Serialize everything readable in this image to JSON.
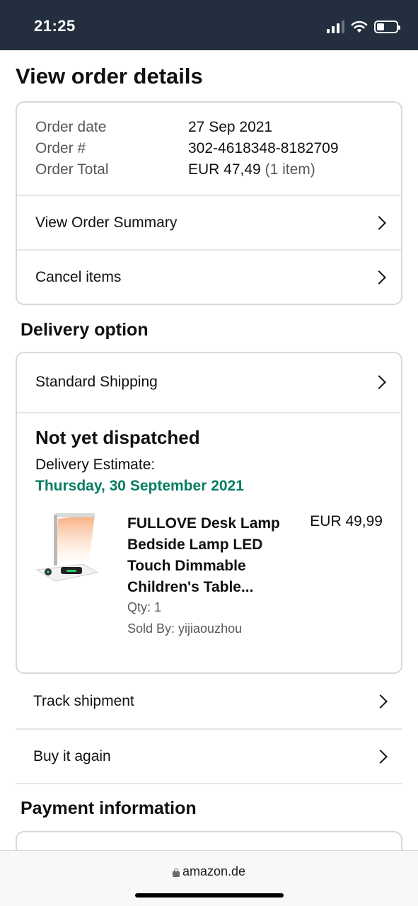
{
  "status_bar": {
    "time": "21:25"
  },
  "page": {
    "title": "View order details"
  },
  "order_summary": {
    "fields": [
      {
        "label": "Order date",
        "value": "27 Sep 2021",
        "extra": ""
      },
      {
        "label": "Order #",
        "value": "302-4618348-8182709",
        "extra": ""
      },
      {
        "label": "Order Total",
        "value": "EUR 47,49",
        "extra": "(1 item)"
      }
    ],
    "view_summary_label": "View Order Summary",
    "cancel_items_label": "Cancel items"
  },
  "delivery": {
    "section_title": "Delivery option",
    "shipping_method": "Standard Shipping",
    "status": "Not yet dispatched",
    "estimate_label": "Delivery Estimate:",
    "estimate_date": "Thursday, 30 September 2021",
    "estimate_color": "#067d62",
    "item": {
      "title": "FULLOVE Desk Lamp Bedside Lamp LED Touch Dimmable Children's Table...",
      "price": "EUR 49,99",
      "qty": "Qty: 1",
      "seller": "Sold By: yijiaouzhou",
      "image_icon": "desk-lamp-product-image"
    },
    "track_shipment_label": "Track shipment",
    "buy_again_label": "Buy it again"
  },
  "payment": {
    "section_title": "Payment information"
  },
  "browser": {
    "url": "amazon.de"
  },
  "colors": {
    "header_bg": "#232f3e",
    "border": "#d5d9d9",
    "muted_text": "#565959"
  }
}
